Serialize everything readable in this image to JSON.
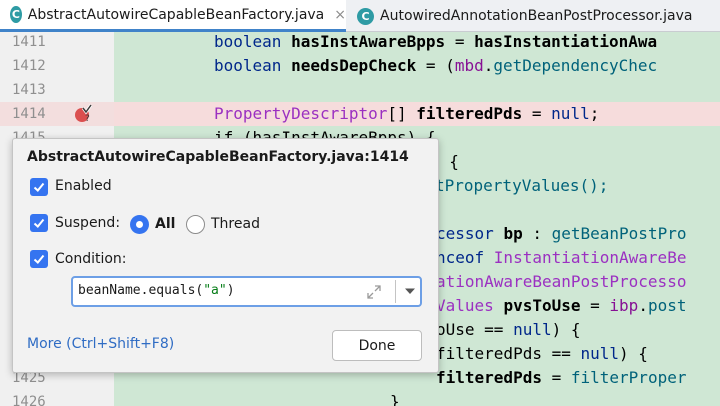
{
  "tabs": [
    {
      "label": "AbstractAutowireCapableBeanFactory.java",
      "icon": "java-class-icon",
      "active": true
    },
    {
      "label": "AutowiredAnnotationBeanPostProcessor.java",
      "icon": "java-class-icon",
      "active": false
    }
  ],
  "tab_icon_letter": "C",
  "close_glyph": "×",
  "line_numbers": [
    "1411",
    "1412",
    "1413",
    "1414",
    "1415",
    "",
    "",
    "",
    "",
    "",
    "",
    "",
    "",
    "",
    "1425",
    "1426"
  ],
  "code": {
    "l1411_a": "boolean ",
    "l1411_b": "hasInstAwareBpps",
    "l1411_c": " = ",
    "l1411_d": "hasInstantiationAwa",
    "l1412_a": "boolean ",
    "l1412_b": "needsDepCheck",
    "l1412_c": " = (",
    "l1412_d": "mbd",
    "l1412_e": ".",
    "l1412_f": "getDependencyChec",
    "l1414_a": "PropertyDescriptor",
    "l1414_b": "[] ",
    "l1414_c": "filteredPds",
    "l1414_d": " = ",
    "l1414_e": "null",
    "l1414_f": ";",
    "l1415": "if (hasInstAwareBpps) {",
    "l1416": "  {",
    "l1417": "tPropertyValues();",
    "l1419_a": "cessor ",
    "l1419_b": "bp",
    "l1419_c": " : ",
    "l1419_d": "getBeanPostPro",
    "l1420_a": "nceof ",
    "l1420_b": "InstantiationAwareBe",
    "l1421": "ationAwareBeanPostProcesso",
    "l1422_a": "Values ",
    "l1422_b": "pvsToUse",
    "l1422_c": " = ",
    "l1422_d": "ibp",
    "l1422_e": ".",
    "l1422_f": "post",
    "l1423_a": "oUse == ",
    "l1423_b": "null",
    "l1423_c": ") {",
    "l1424_a": "filteredPds == ",
    "l1424_b": "null",
    "l1424_c": ") {",
    "l1425_a": "filteredPds",
    "l1425_b": " = ",
    "l1425_c": "filterProper",
    "l1426": "}"
  },
  "breakpoint_popup": {
    "title": "AbstractAutowireCapableBeanFactory.java:1414",
    "enabled_label": "Enabled",
    "enabled_checked": true,
    "suspend_label": "Suspend:",
    "suspend_checked": true,
    "suspend_options": [
      {
        "label": "All",
        "selected": true
      },
      {
        "label": "Thread",
        "selected": false
      }
    ],
    "condition_label": "Condition:",
    "condition_checked": true,
    "condition_value_a": "beanName.equals(",
    "condition_value_b": "\"a\"",
    "condition_value_c": ")",
    "more_link": "More (Ctrl+Shift+F8)",
    "done_button": "Done"
  },
  "colors": {
    "accent": "#3574f0",
    "code_background": "#cfe7d4",
    "breakpoint_line": "#f6dcdc",
    "keyword": "#00278a",
    "link": "#2f6cc4"
  }
}
